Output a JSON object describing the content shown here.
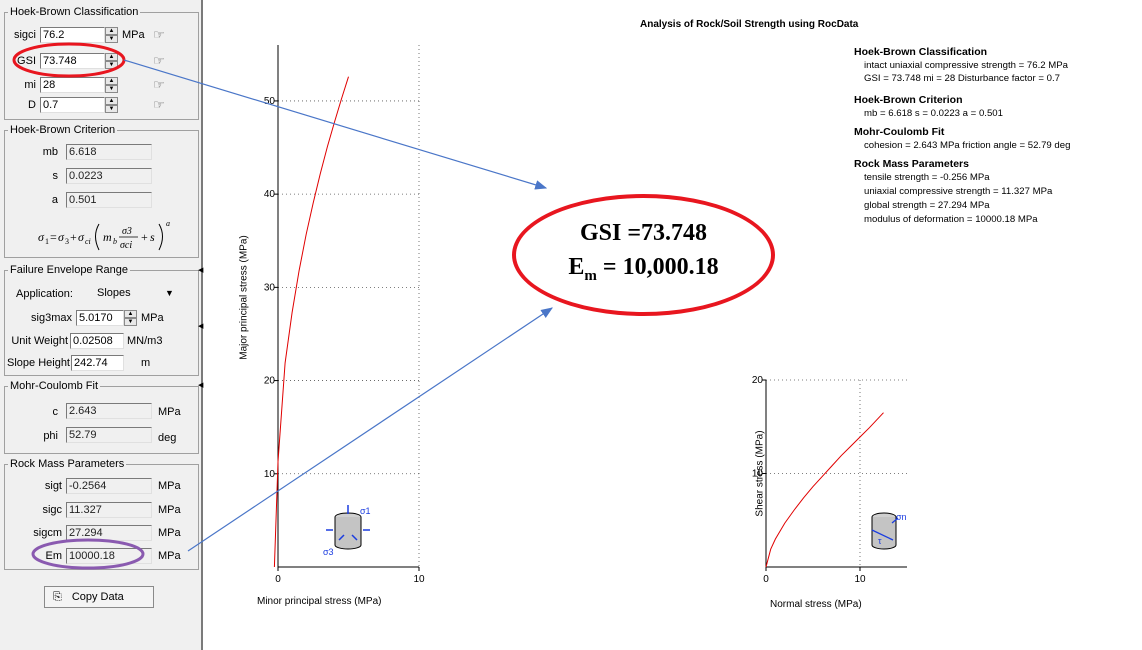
{
  "panel": {
    "hb_class": {
      "legend": "Hoek-Brown Classification",
      "sigci_label": "sigci",
      "sigci_value": "76.2",
      "sigci_unit": "MPa",
      "gsi_label": "GSI",
      "gsi_value": "73.748",
      "mi_label": "mi",
      "mi_value": "28",
      "d_label": "D",
      "d_value": "0.7",
      "pick_icon": "hand-pointer-icon"
    },
    "hb_crit": {
      "legend": "Hoek-Brown Criterion",
      "mb_label": "mb",
      "mb_value": "6.618",
      "s_label": "s",
      "s_value": "0.0223",
      "a_label": "a",
      "a_value": "0.501"
    },
    "envelope": {
      "legend": "Failure Envelope Range",
      "app_label": "Application:",
      "app_value": "Slopes",
      "sig3max_label": "sig3max",
      "sig3max_value": "5.0170",
      "sig3max_unit": "MPa",
      "uw_label": "Unit Weight",
      "uw_value": "0.02508",
      "uw_unit": "MN/m3",
      "sh_label": "Slope Height",
      "sh_value": "242.74",
      "sh_unit": "m"
    },
    "mc": {
      "legend": "Mohr-Coulomb Fit",
      "c_label": "c",
      "c_value": "2.643",
      "c_unit": "MPa",
      "phi_label": "phi",
      "phi_value": "52.79",
      "phi_unit": "deg"
    },
    "rm": {
      "legend": "Rock Mass Parameters",
      "sigt_label": "sigt",
      "sigt_value": "-0.2564",
      "sigt_unit": "MPa",
      "sigc_label": "sigc",
      "sigc_value": "11.327",
      "sigc_unit": "MPa",
      "sigcm_label": "sigcm",
      "sigcm_value": "27.294",
      "sigcm_unit": "MPa",
      "em_label": "Em",
      "em_value": "10000.18",
      "em_unit": "MPa"
    },
    "copy_label": "Copy Data"
  },
  "report": {
    "title": "Analysis of Rock/Soil Strength using RocData",
    "h1": "Hoek-Brown Classification",
    "l1a": "intact uniaxial compressive strength = 76.2 MPa",
    "l1b": "GSI = 73.748    mi = 28    Disturbance factor = 0.7",
    "h2": "Hoek-Brown Criterion",
    "l2a": "mb = 6.618    s = 0.0223    a = 0.501",
    "h3": "Mohr-Coulomb Fit",
    "l3a": "cohesion = 2.643 MPa    friction angle = 52.79 deg",
    "h4": "Rock Mass Parameters",
    "l4a": "tensile strength = -0.256 MPa",
    "l4b": "uniaxial compressive strength = 11.327 MPa",
    "l4c": "global strength = 27.294 MPa",
    "l4d": "modulus of deformation = 10000.18 MPa"
  },
  "annotation": {
    "gsi_text": "GSI =73.748",
    "em_prefix": "E",
    "em_sub": "m",
    "em_text": " = 10,000.18"
  },
  "chart_data": [
    {
      "type": "line",
      "xlabel": "Minor principal stress (MPa)",
      "ylabel": "Major principal stress (MPa)",
      "xlim": [
        0,
        10
      ],
      "ylim": [
        0,
        56
      ],
      "x_ticks": [
        "0",
        "10"
      ],
      "y_ticks": [
        "10",
        "20",
        "30",
        "40",
        "50"
      ],
      "grid": true,
      "series": [
        {
          "color": "#e00000",
          "x": [
            -0.256,
            0,
            0.5,
            1,
            1.5,
            2,
            2.5,
            3,
            3.5,
            4,
            4.5,
            5.0
          ],
          "y": [
            0,
            11.3,
            21.9,
            27.3,
            31.8,
            35.7,
            39.1,
            42.2,
            45.1,
            47.7,
            50.2,
            52.6
          ]
        }
      ]
    },
    {
      "type": "line",
      "xlabel": "Normal stress (MPa)",
      "ylabel": "Shear stress (MPa)",
      "xlim": [
        0,
        15
      ],
      "ylim": [
        0,
        20
      ],
      "x_ticks": [
        "0",
        "10"
      ],
      "y_ticks": [
        "10",
        "20"
      ],
      "grid": true,
      "series": [
        {
          "color": "#e00000",
          "x": [
            0,
            0.5,
            1,
            2,
            3,
            4,
            5,
            6,
            7,
            8,
            9,
            10,
            11,
            12.5
          ],
          "y": [
            0,
            1.9,
            3.0,
            4.7,
            6.1,
            7.4,
            8.6,
            9.7,
            10.8,
            11.9,
            12.9,
            13.9,
            14.9,
            16.5
          ]
        }
      ]
    }
  ]
}
